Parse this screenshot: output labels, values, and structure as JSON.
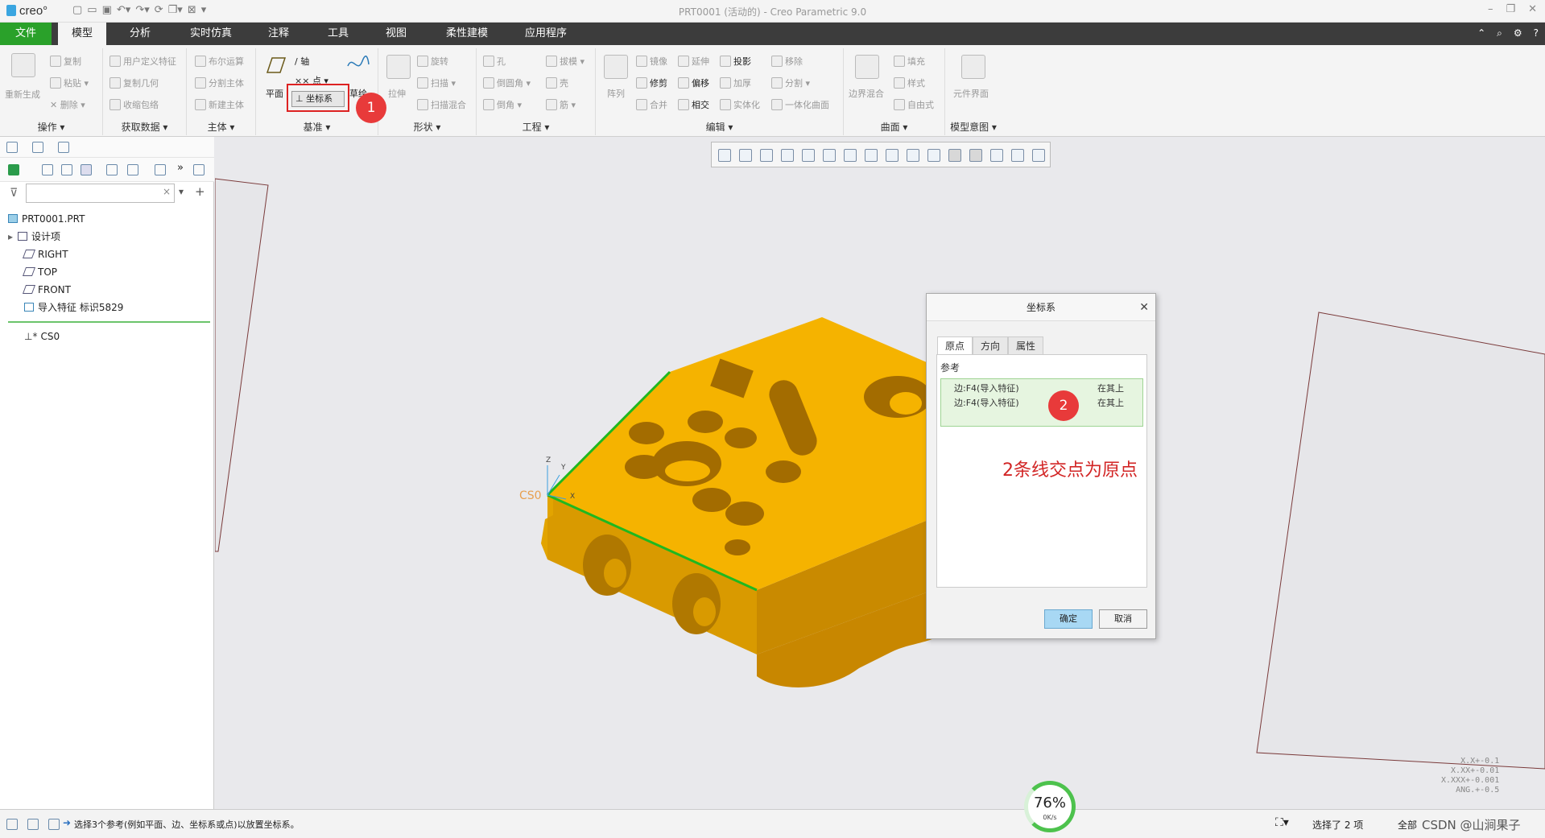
{
  "app": {
    "logo": "creo°",
    "title": "PRT0001 (活动的) - Creo Parametric 9.0"
  },
  "tabs": [
    "文件",
    "模型",
    "分析",
    "实时仿真",
    "注释",
    "工具",
    "视图",
    "柔性建模",
    "应用程序"
  ],
  "ribbon": {
    "operations": {
      "regen": "重新生成",
      "copy": "复制",
      "paste": "粘贴",
      "delete": "删除",
      "label": "操作"
    },
    "get_data": {
      "udf": "用户定义特征",
      "copy_geom": "复制几何",
      "shrinkwrap": "收缩包络",
      "label": "获取数据"
    },
    "body": {
      "boolean": "布尔运算",
      "split": "分割主体",
      "new": "新建主体",
      "label": "主体"
    },
    "datum": {
      "plane": "平面",
      "axis": "轴",
      "point": "点",
      "csys": "坐标系",
      "sketch": "草绘",
      "label": "基准"
    },
    "shapes": {
      "extrude": "拉伸",
      "revolve": "旋转",
      "sweep": "扫描",
      "swept_blend": "扫描混合",
      "label": "形状"
    },
    "engineering": {
      "hole": "孔",
      "round": "倒圆角",
      "chamfer": "倒角",
      "draft": "拔模",
      "shell": "壳",
      "rib": "筋",
      "label": "工程"
    },
    "editing": {
      "pattern": "阵列",
      "mirror": "镜像",
      "trim": "修剪",
      "merge": "合并",
      "extend": "延伸",
      "offset": "偏移",
      "intersect": "相交",
      "project": "投影",
      "thicken": "加厚",
      "solidify": "实体化",
      "remove": "移除",
      "split": "分割",
      "unify": "一体化曲面",
      "label": "编辑"
    },
    "surfaces": {
      "boundary": "边界混合",
      "fill": "填充",
      "style": "样式",
      "freestyle": "自由式",
      "label": "曲面"
    },
    "intent": {
      "component": "元件界面",
      "label": "模型意图"
    }
  },
  "callouts": {
    "one": "1",
    "two": "2"
  },
  "tree": {
    "filter_placeholder": "",
    "items": [
      "PRT0001.PRT",
      "设计项",
      "RIGHT",
      "TOP",
      "FRONT",
      "导入特征 标识5829",
      "CS0"
    ]
  },
  "viewport": {
    "csys_label": "CS0",
    "axis_z": "Z",
    "axis_y": "Y",
    "axis_x": "X",
    "tolerances": [
      "X.X+-0.1",
      "X.XX+-0.01",
      "X.XXX+-0.001",
      "ANG.+-0.5"
    ]
  },
  "dialog": {
    "title": "坐标系",
    "tabs": [
      "原点",
      "方向",
      "属性"
    ],
    "ref_label": "参考",
    "refs": [
      {
        "ref": "边:F4(导入特征)",
        "type": "在其上"
      },
      {
        "ref": "边:F4(导入特征)",
        "type": "在其上"
      }
    ],
    "ok": "确定",
    "cancel": "取消"
  },
  "note": "2条线交点为原点",
  "status": {
    "message": "选择3个参考(例如平面、边、坐标系或点)以放置坐标系。",
    "selected": "选择了 2 项",
    "filter": "全部",
    "watermark": "CSDN @山涧果子",
    "gauge_value": "76%",
    "gauge_sub": "0K/s"
  },
  "colors": {
    "accent": "#2aa12a",
    "part": "#f5b300",
    "callout": "#e83a3a",
    "note": "#d22525"
  }
}
